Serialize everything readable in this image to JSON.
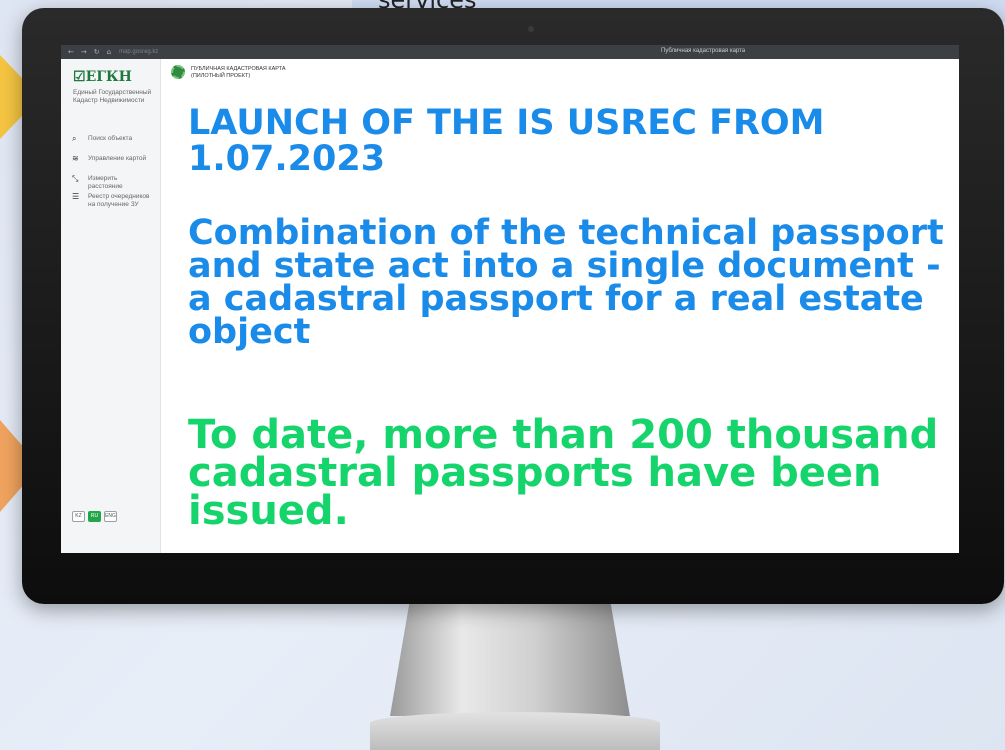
{
  "slide": {
    "top_text": "services"
  },
  "browser": {
    "url": "map.gosreg.kz",
    "tab_title": "Публичная кадастровая карта"
  },
  "sidebar": {
    "logo": "ЕГКН",
    "logo_subtitle": "Единый Государственный Кадастр Недвижимости",
    "items": [
      {
        "label": "Поиск объекта",
        "icon": "search-icon"
      },
      {
        "label": "Управление картой",
        "icon": "layers-icon"
      },
      {
        "label": "Измерить расстояние",
        "icon": "ruler-icon"
      },
      {
        "label": "Реестр очередников на получение ЗУ",
        "icon": "list-icon"
      }
    ],
    "languages": [
      "KZ",
      "RU",
      "ENG"
    ],
    "active_language": "RU"
  },
  "header": {
    "title_line1": "ПУБЛИЧНАЯ КАДАСТРОВАЯ КАРТА",
    "title_line2": "(ПИЛОТНЫЙ ПРОЕКТ)"
  },
  "content": {
    "headline": "LAUNCH OF THE IS USREC FROM 1.07.2023",
    "paragraph": "Combination of the technical passport and state act into a single document - a cadastral passport for a real estate object",
    "highlight": "To date, more than 200 thousand cadastral passports have been issued."
  },
  "colors": {
    "headline": "#1a8be8",
    "highlight": "#16d46c",
    "brand_green": "#22a64a"
  }
}
